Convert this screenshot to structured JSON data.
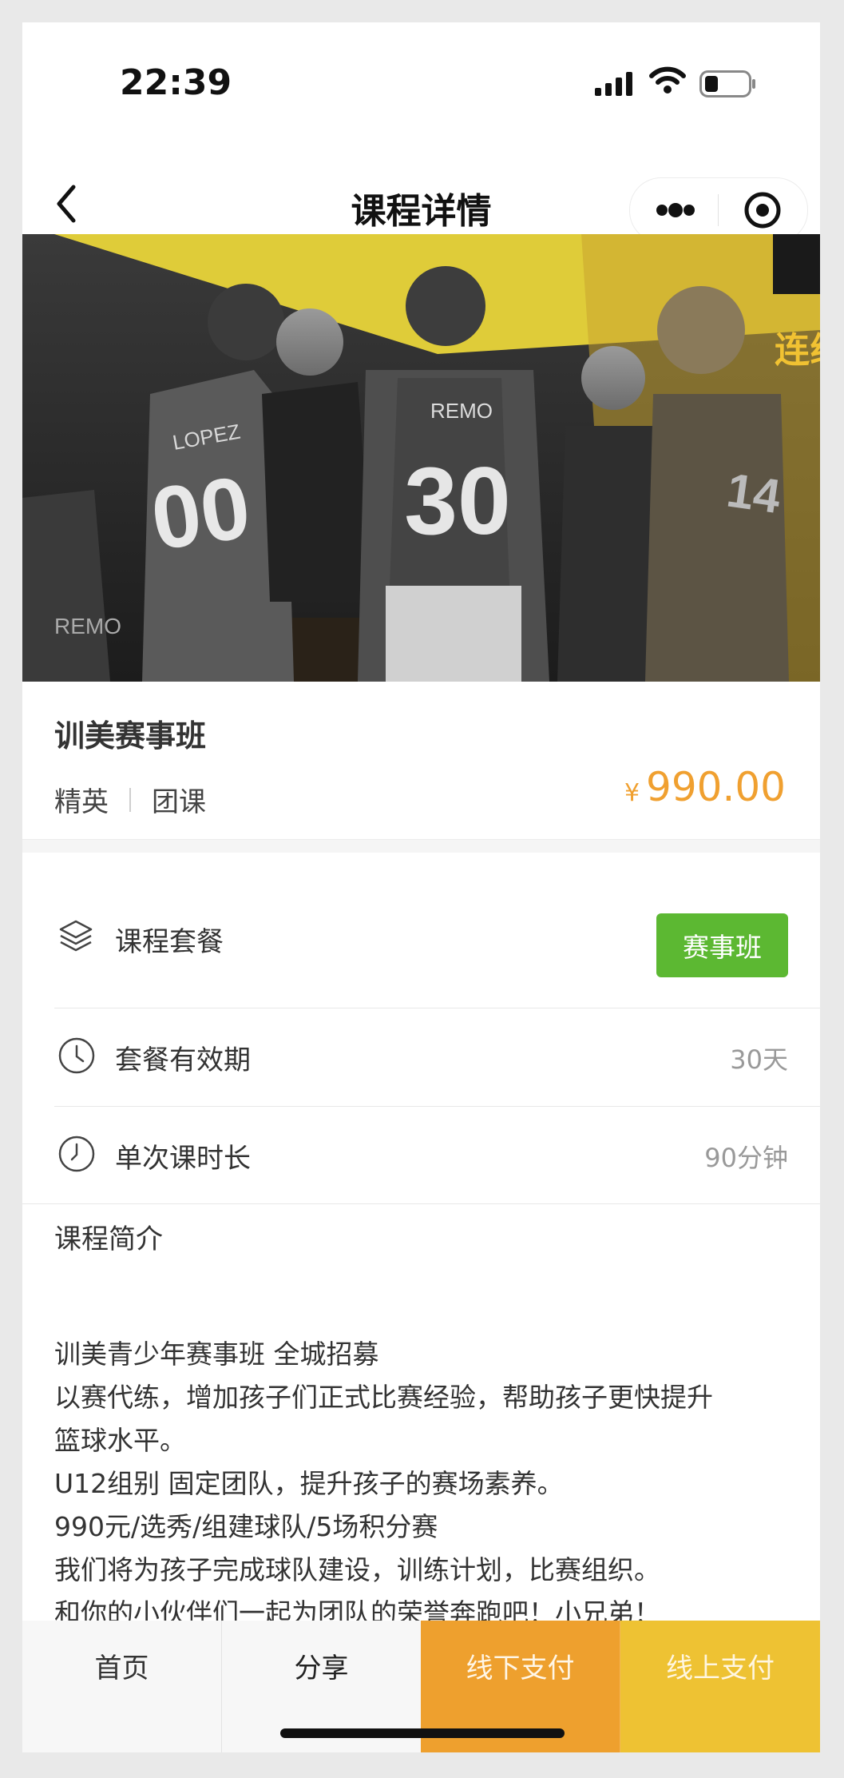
{
  "status_bar": {
    "time": "22:39"
  },
  "nav": {
    "title": "课程详情"
  },
  "course": {
    "title": "训美赛事班",
    "tags": [
      "精英",
      "团课"
    ],
    "price_currency": "¥",
    "price": "990.00"
  },
  "hero": {
    "jersey_names": [
      "LOPEZ",
      "REMO"
    ],
    "jersey_numbers": [
      "00",
      "30"
    ],
    "banner_text": "连线"
  },
  "rows": {
    "package": {
      "label": "课程套餐",
      "button": "赛事班"
    },
    "validity": {
      "label": "套餐有效期",
      "value": "30天"
    },
    "duration": {
      "label": "单次课时长",
      "value": "90分钟"
    }
  },
  "description": {
    "heading": "课程简介",
    "lines": [
      "训美青少年赛事班 全城招募",
      "以赛代练，增加孩子们正式比赛经验，帮助孩子更快提升",
      "篮球水平。",
      "U12组别 固定团队，提升孩子的赛场素养。",
      "990元/选秀/组建球队/5场积分赛",
      "我们将为孩子完成球队建设，训练计划，比赛组织。",
      "和你的小伙伴们一起为团队的荣誉奔跑吧！小兄弟！"
    ]
  },
  "bottom_bar": {
    "home": "首页",
    "share": "分享",
    "offline_pay": "线下支付",
    "online_pay": "线上支付"
  },
  "colors": {
    "price": "#f0a030",
    "package_button": "#5cb832",
    "offline_pay_bg": "#eea02e",
    "online_pay_bg": "#eec233"
  }
}
